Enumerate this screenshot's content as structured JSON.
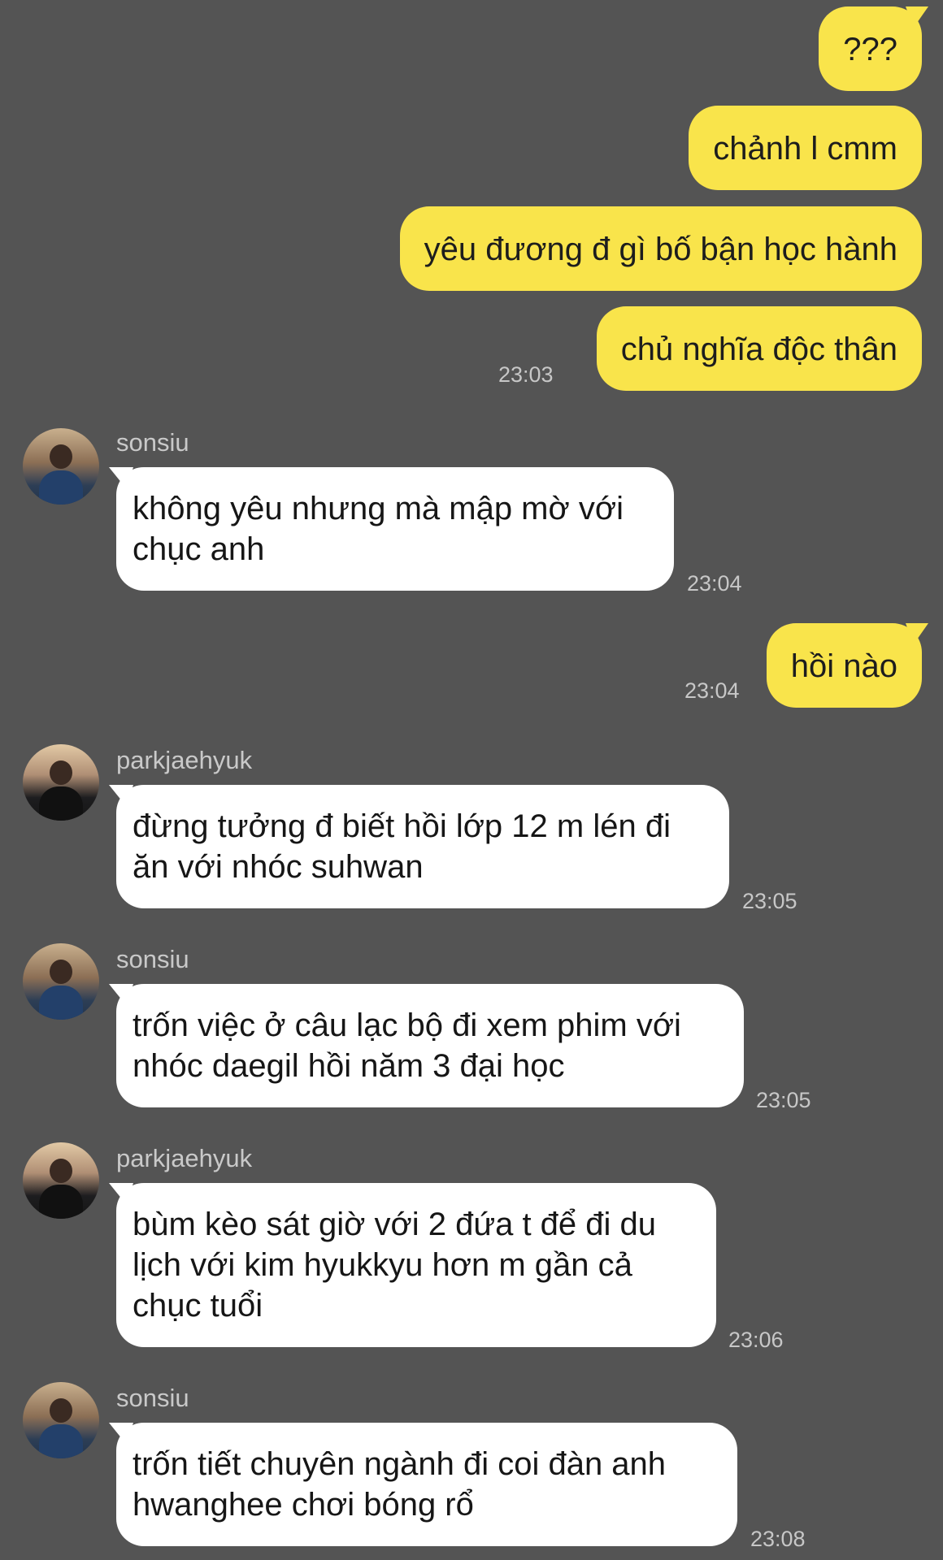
{
  "messages": [
    {
      "from": "me",
      "text": "???"
    },
    {
      "from": "me",
      "text": "chảnh l cmm"
    },
    {
      "from": "me",
      "text": "yêu đương đ gì bố bận học hành"
    },
    {
      "from": "me",
      "text": "chủ nghĩa độc thân",
      "time": "23:03"
    },
    {
      "from": "sonsiu",
      "sender": "sonsiu",
      "text": "không yêu nhưng mà mập mờ với chục anh",
      "time": "23:04"
    },
    {
      "from": "me",
      "text": "hồi nào",
      "time": "23:04"
    },
    {
      "from": "parkjaehyuk",
      "sender": "parkjaehyuk",
      "text": "đừng tưởng đ biết hồi lớp 12 m lén đi ăn với nhóc suhwan",
      "time": "23:05"
    },
    {
      "from": "sonsiu",
      "sender": "sonsiu",
      "text": "trốn việc ở câu lạc bộ đi xem phim với nhóc daegil hồi năm 3 đại học",
      "time": "23:05"
    },
    {
      "from": "parkjaehyuk",
      "sender": "parkjaehyuk",
      "text": "bùm kèo sát giờ với 2 đứa t để đi du lịch với kim hyukkyu hơn m gần cả chục tuổi",
      "time": "23:06"
    },
    {
      "from": "sonsiu",
      "sender": "sonsiu",
      "text": "trốn tiết chuyên ngành đi coi đàn anh hwanghee chơi bóng rổ",
      "time": "23:08"
    }
  ],
  "colors": {
    "background": "#545454",
    "outgoing_bubble": "#f9e44b",
    "incoming_bubble": "#ffffff"
  }
}
